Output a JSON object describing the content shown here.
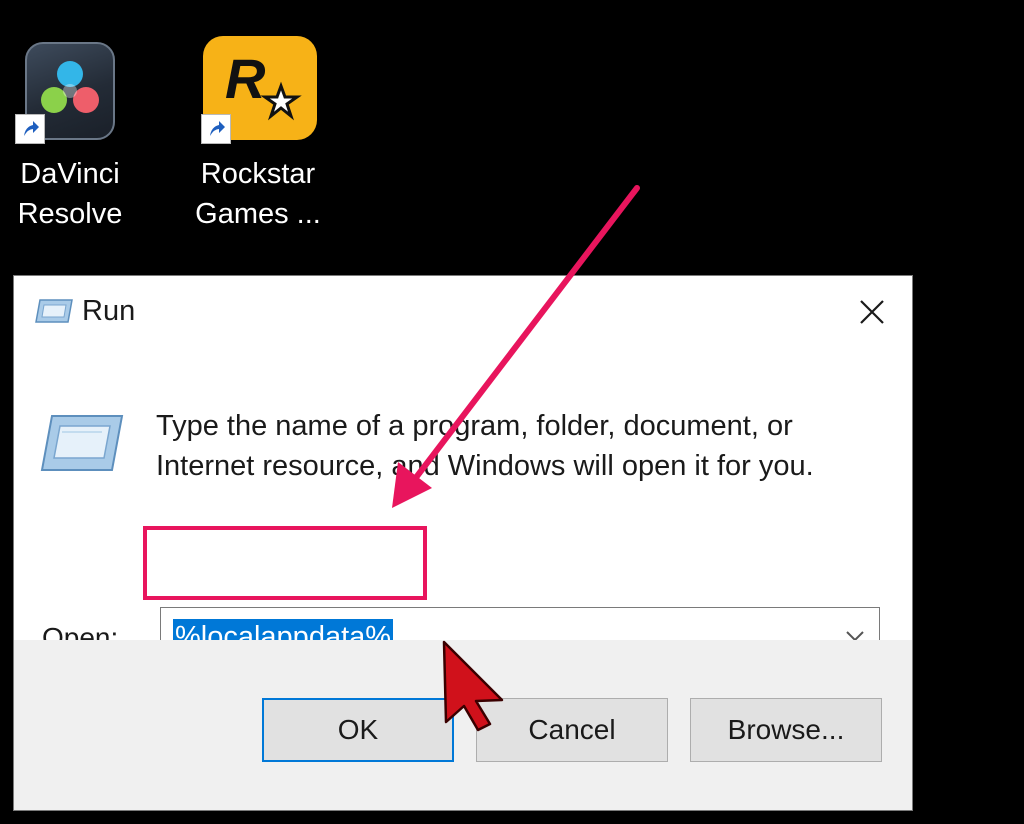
{
  "desktop": {
    "icons": [
      {
        "label_line1": "DaVinci",
        "label_line2": "Resolve",
        "icon": "davinci-resolve-icon"
      },
      {
        "label_line1": "Rockstar",
        "label_line2": "Games ...",
        "icon": "rockstar-games-icon"
      }
    ]
  },
  "dialog": {
    "title": "Run",
    "description": "Type the name of a program, folder, document, or Internet resource, and Windows will open it for you.",
    "open_label": "Open:",
    "open_value": "%localappdata%",
    "buttons": {
      "ok": "OK",
      "cancel": "Cancel",
      "browse": "Browse..."
    }
  },
  "annotation": {
    "highlight_color": "#e8155d",
    "arrow_color": "#e8155d",
    "cursor_color": "#d0111b"
  },
  "theme": {
    "selection_color": "#0078d7",
    "footer_background": "#f0f0f0",
    "rockstar_yellow": "#f7b217"
  }
}
